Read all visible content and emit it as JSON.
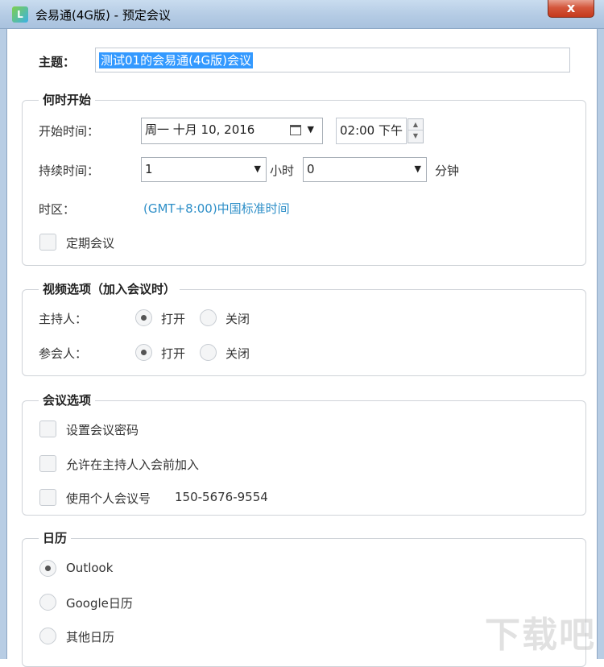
{
  "window": {
    "app_icon": "app-logo-icon",
    "title": "会易通(4G版) - 预定会议",
    "close_icon": "x"
  },
  "subject": {
    "label": "主题：",
    "value": "测试01的会易通(4G版)会议"
  },
  "when": {
    "group_title": "何时开始",
    "start_label": "开始时间：",
    "date_value": "周一   十月  10, 2016",
    "time_value": "02:00 下午",
    "duration_label": "持续时间：",
    "hours_value": "1",
    "hours_unit": "小时",
    "minutes_value": "0",
    "minutes_unit": "分钟",
    "timezone_label": "时区：",
    "timezone_value": "(GMT+8:00)中国标准时间",
    "recurring_label": "定期会议",
    "recurring_checked": false
  },
  "video": {
    "group_title": "视频选项（加入会议时）",
    "host_label": "主持人：",
    "host_on": "打开",
    "host_off": "关闭",
    "host_selected": "on",
    "participant_label": "参会人：",
    "participant_on": "打开",
    "participant_off": "关闭",
    "participant_selected": "on"
  },
  "meeting_options": {
    "group_title": "会议选项",
    "password_label": "设置会议密码",
    "join_before_host_label": "允许在主持人入会前加入",
    "personal_id_label": "使用个人会议号",
    "personal_id_value": "150-5676-9554"
  },
  "calendar": {
    "group_title": "日历",
    "options": [
      "Outlook",
      "Google日历",
      "其他日历"
    ],
    "selected": "Outlook"
  },
  "watermark": "下载吧"
}
